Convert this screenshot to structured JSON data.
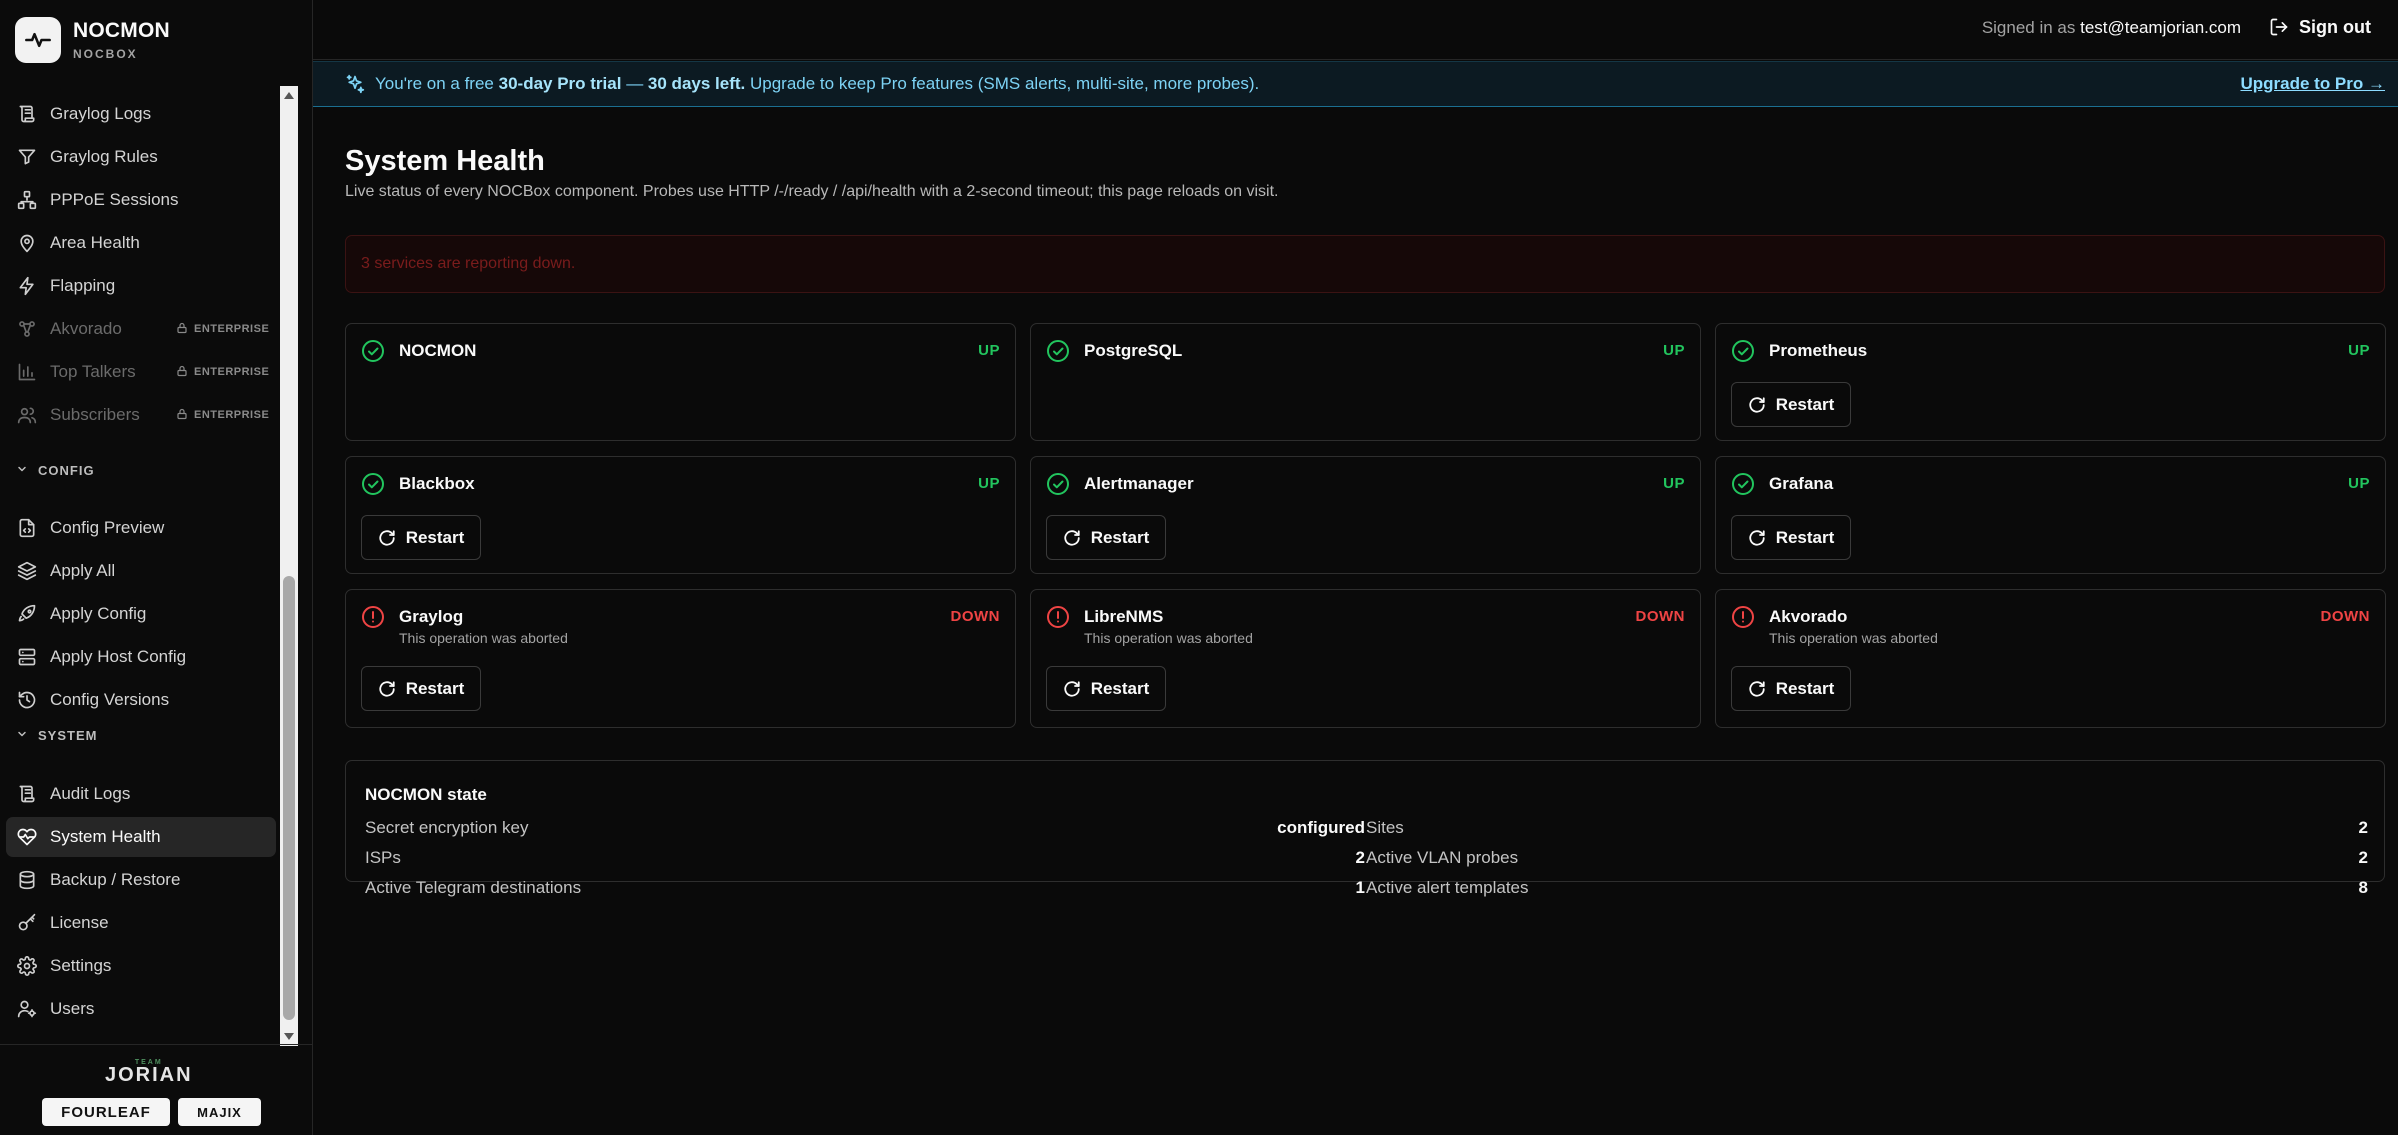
{
  "brand": {
    "name": "NOCMON",
    "sub": "NOCBOX"
  },
  "nav": {
    "items_top": [
      {
        "label": "Graylog Logs",
        "icon": "scroll-icon"
      },
      {
        "label": "Graylog Rules",
        "icon": "filter-icon"
      },
      {
        "label": "PPPoE Sessions",
        "icon": "network-icon"
      },
      {
        "label": "Area Health",
        "icon": "map-pin-icon"
      },
      {
        "label": "Flapping",
        "icon": "zap-icon"
      },
      {
        "label": "Akvorado",
        "icon": "workflow-icon",
        "badge": "ENTERPRISE"
      },
      {
        "label": "Top Talkers",
        "icon": "bar-chart-icon",
        "badge": "ENTERPRISE"
      },
      {
        "label": "Subscribers",
        "icon": "users-icon",
        "badge": "ENTERPRISE"
      }
    ],
    "config_label": "CONFIG",
    "config_items": [
      {
        "label": "Config Preview",
        "icon": "file-code-icon"
      },
      {
        "label": "Apply All",
        "icon": "layers-icon"
      },
      {
        "label": "Apply Config",
        "icon": "rocket-icon"
      },
      {
        "label": "Apply Host Config",
        "icon": "server-icon"
      },
      {
        "label": "Config Versions",
        "icon": "history-icon"
      }
    ],
    "system_label": "SYSTEM",
    "system_items": [
      {
        "label": "Audit Logs",
        "icon": "scroll-icon"
      },
      {
        "label": "System Health",
        "icon": "heart-pulse-icon",
        "active": true
      },
      {
        "label": "Backup / Restore",
        "icon": "database-icon"
      },
      {
        "label": "License",
        "icon": "key-icon"
      },
      {
        "label": "Settings",
        "icon": "gear-icon"
      },
      {
        "label": "Users",
        "icon": "user-cog-icon"
      }
    ]
  },
  "footer": {
    "team_small": "TEAM",
    "team_big": "JORIAN",
    "partner1": "FOURLEAF",
    "partner2": "MAJIX"
  },
  "topbar": {
    "signed_prefix": "Signed in as",
    "user_email": "test@teamjorian.com",
    "signout": "Sign out"
  },
  "banner": {
    "prefix": "You're on a free",
    "trial": "30-day Pro trial",
    "dash": "—",
    "days": "30 days left.",
    "rest": "Upgrade to keep Pro features (SMS alerts, multi-site, more probes).",
    "upgrade": "Upgrade to Pro →"
  },
  "page": {
    "title": "System Health",
    "description": "Live status of every NOCBox component. Probes use HTTP /-/ready / /api/health with a 2-second timeout; this page reloads on visit."
  },
  "alert": {
    "text": "3 services are reporting down."
  },
  "restart_label": "Restart",
  "services": [
    {
      "name": "NOCMON",
      "status": "UP",
      "restart": false
    },
    {
      "name": "PostgreSQL",
      "status": "UP",
      "restart": false
    },
    {
      "name": "Prometheus",
      "status": "UP",
      "restart": true
    },
    {
      "name": "Blackbox",
      "status": "UP",
      "restart": true
    },
    {
      "name": "Alertmanager",
      "status": "UP",
      "restart": true
    },
    {
      "name": "Grafana",
      "status": "UP",
      "restart": true
    },
    {
      "name": "Graylog",
      "status": "DOWN",
      "error": "This operation was aborted",
      "restart": true
    },
    {
      "name": "LibreNMS",
      "status": "DOWN",
      "error": "This operation was aborted",
      "restart": true
    },
    {
      "name": "Akvorado",
      "status": "DOWN",
      "error": "This operation was aborted",
      "restart": true
    }
  ],
  "state": {
    "title": "NOCMON state",
    "rows": [
      {
        "k": "Secret encryption key",
        "v": "configured"
      },
      {
        "k": "Sites",
        "v": "2"
      },
      {
        "k": "ISPs",
        "v": "2"
      },
      {
        "k": "Active VLAN probes",
        "v": "2"
      },
      {
        "k": "Active Telegram destinations",
        "v": "1"
      },
      {
        "k": "Active alert templates",
        "v": "8"
      }
    ]
  },
  "colors": {
    "up": "#22c55e",
    "down": "#ef4444",
    "accent": "#7dd3f5"
  }
}
